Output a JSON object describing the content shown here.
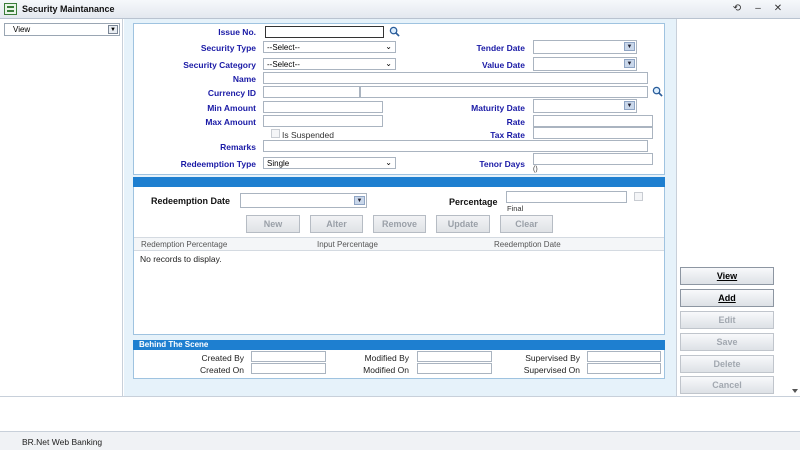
{
  "window": {
    "title": "Security Maintanance"
  },
  "left_panel": {
    "view_dropdown": "View"
  },
  "form": {
    "issue_no_label": "Issue No.",
    "issue_no_value": "",
    "security_type_label": "Security Type",
    "security_type_value": "--Select--",
    "security_category_label": "Security Category",
    "security_category_value": "--Select--",
    "name_label": "Name",
    "currency_id_label": "Currency ID",
    "min_amount_label": "Min Amount",
    "max_amount_label": "Max Amount",
    "is_suspended_label": "Is Suspended",
    "remarks_label": "Remarks",
    "redeemption_type_label": "Redeemption Type",
    "redeemption_type_value": "Single",
    "tender_date_label": "Tender Date",
    "value_date_label": "Value Date",
    "maturity_date_label": "Maturity Date",
    "rate_label": "Rate",
    "tax_rate_label": "Tax Rate",
    "tenor_days_label": "Tenor Days",
    "tenor_days_hint": "()"
  },
  "redemption": {
    "date_label": "Redeemption Date",
    "percentage_label": "Percentage",
    "final_label": "Final",
    "buttons": {
      "new": "New",
      "alter": "Alter",
      "remove": "Remove",
      "update": "Update",
      "clear": "Clear"
    },
    "columns": [
      "Redemption Percentage",
      "Input Percentage",
      "Reedemption Date"
    ],
    "empty_message": "No records to display."
  },
  "behind_the_scene": {
    "title": "Behind The Scene",
    "created_by": "Created By",
    "created_on": "Created On",
    "modified_by": "Modified By",
    "modified_on": "Modified On",
    "supervised_by": "Supervised By",
    "supervised_on": "Supervised On"
  },
  "actions": {
    "view": "View",
    "add": "Add",
    "edit": "Edit",
    "save": "Save",
    "delete": "Delete",
    "cancel": "Cancel"
  },
  "status_bar": {
    "text": "BR.Net Web Banking"
  },
  "colors": {
    "label_blue": "#1a1aa6",
    "header_bar_blue": "#1e7fd0",
    "panel_bg": "#e6f2fa"
  }
}
